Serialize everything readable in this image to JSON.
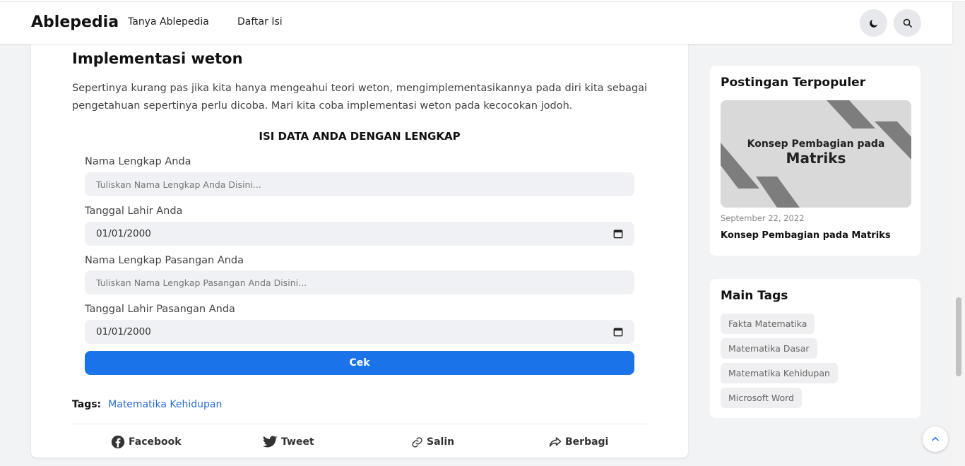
{
  "header": {
    "logo": "Ablepedia",
    "nav": [
      "Tanya Ablepedia",
      "Daftar Isi"
    ],
    "icons": [
      "moon-icon",
      "search-icon"
    ]
  },
  "article": {
    "section_title": "Implementasi weton",
    "paragraph": "Sepertinya kurang pas jika kita hanya mengeahui teori weton, mengimplementasikannya pada diri kita sebagai pengetahuan sepertinya perlu dicoba. Mari kita coba implementasi weton pada kecocokan jodoh.",
    "form": {
      "title": "ISI DATA ANDA DENGAN LENGKAP",
      "name_label": "Nama Lengkap Anda",
      "name_placeholder": "Tuliskan Nama Lengkap Anda Disini...",
      "dob_label": "Tanggal Lahir Anda",
      "dob_value": "01/01/2000",
      "partner_name_label": "Nama Lengkap Pasangan Anda",
      "partner_name_placeholder": "Tuliskan Nama Lengkap Pasangan Anda Disini...",
      "partner_dob_label": "Tanggal Lahir Pasangan Anda",
      "partner_dob_value": "01/01/2000",
      "submit_label": "Cek"
    },
    "tags_label": "Tags:",
    "tag": "Matematika Kehidupan",
    "share": {
      "facebook": "Facebook",
      "tweet": "Tweet",
      "copy": "Salin",
      "share": "Berbagi"
    }
  },
  "sidebar": {
    "popular": {
      "title": "Postingan Terpopuler",
      "thumb_line1": "Konsep Pembagian pada",
      "thumb_line2": "Matriks",
      "date": "September 22, 2022",
      "post_title": "Konsep Pembagian pada Matriks"
    },
    "tags": {
      "title": "Main Tags",
      "items": [
        "Fakta Matematika",
        "Matematika Dasar",
        "Matematika Kehidupan",
        "Microsoft Word"
      ]
    }
  },
  "colors": {
    "accent": "#1a73e8",
    "link": "#2a6bd6",
    "field_bg": "#f0f1f4",
    "page_bg": "#f2f3f5"
  }
}
